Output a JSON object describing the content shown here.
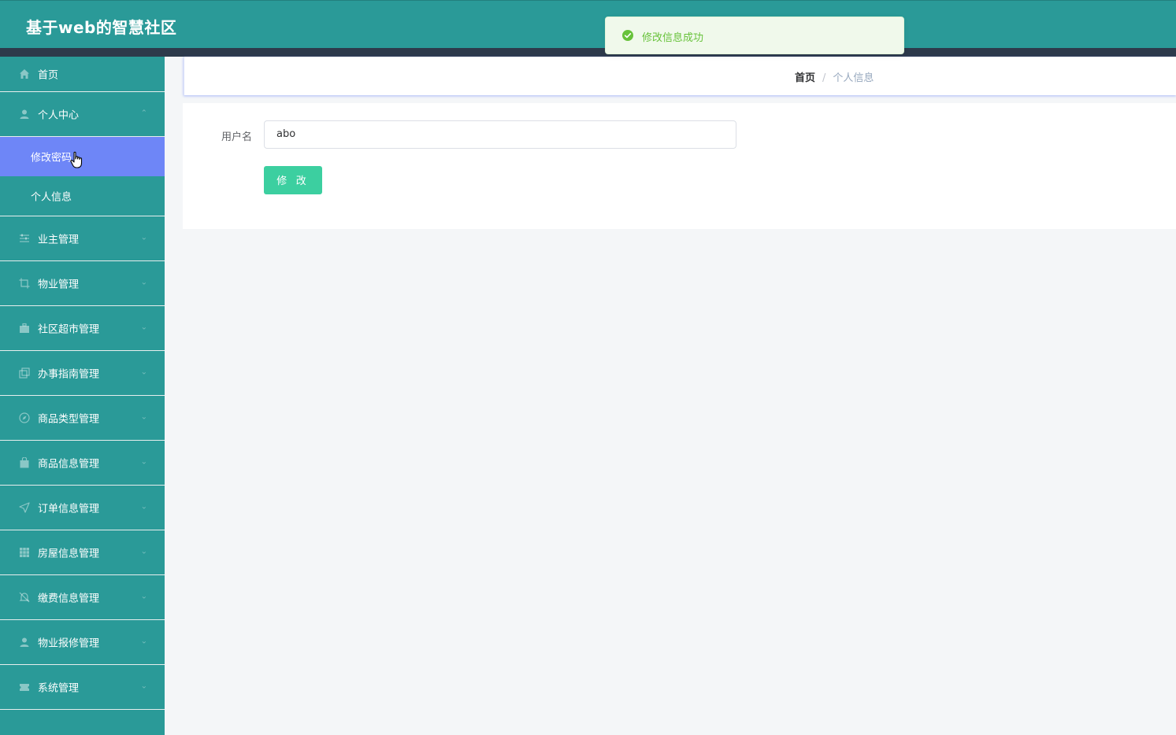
{
  "app": {
    "title": "基于web的智慧社区"
  },
  "toast": {
    "message": "修改信息成功",
    "icon": "success-check-icon",
    "color": "#67c23a"
  },
  "sidebar": {
    "items": [
      {
        "label": "首页",
        "icon": "home-icon"
      },
      {
        "label": "个人中心",
        "icon": "user-icon",
        "expanded": true,
        "children": [
          {
            "label": "修改密码",
            "active": true
          },
          {
            "label": "个人信息",
            "active": false
          }
        ]
      },
      {
        "label": "业主管理",
        "icon": "sliders-icon"
      },
      {
        "label": "物业管理",
        "icon": "crop-icon"
      },
      {
        "label": "社区超市管理",
        "icon": "briefcase-icon"
      },
      {
        "label": "办事指南管理",
        "icon": "copy-icon"
      },
      {
        "label": "商品类型管理",
        "icon": "compass-icon"
      },
      {
        "label": "商品信息管理",
        "icon": "bag-icon"
      },
      {
        "label": "订单信息管理",
        "icon": "send-icon"
      },
      {
        "label": "房屋信息管理",
        "icon": "grid-icon"
      },
      {
        "label": "缴费信息管理",
        "icon": "bell-off-icon"
      },
      {
        "label": "物业报修管理",
        "icon": "user-icon"
      },
      {
        "label": "系统管理",
        "icon": "ticket-icon"
      }
    ]
  },
  "breadcrumb": {
    "home": "首页",
    "separator": "/",
    "current": "个人信息"
  },
  "form": {
    "username_label": "用户名",
    "username_value": "abo",
    "submit_label": "修 改"
  },
  "colors": {
    "primary_teal": "#2a9a98",
    "dark_band": "#2d3a4b",
    "active_submenu": "#6e86f7",
    "button": "#3ccfa0"
  }
}
